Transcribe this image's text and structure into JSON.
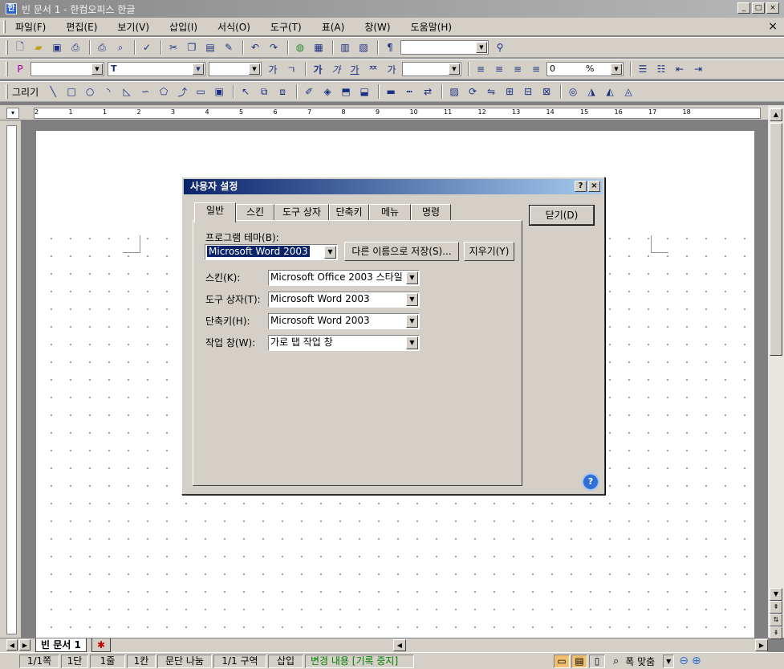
{
  "window": {
    "title": "빈 문서 1 - 한컴오피스 한글",
    "app_icon_glyph": "한"
  },
  "menu": {
    "items": [
      "파일(F)",
      "편집(E)",
      "보기(V)",
      "삽입(I)",
      "서식(O)",
      "도구(T)",
      "표(A)",
      "창(W)",
      "도움말(H)"
    ],
    "close_glyph": "×"
  },
  "toolbar_draw": {
    "label": "그리기"
  },
  "format_toolbar": {
    "font_value": "T",
    "size_value": "0",
    "percent": "%"
  },
  "colors": {
    "dialog_title_start": "#0a246a",
    "dialog_title_end": "#a6caf0",
    "selection": "#0a246a",
    "status_green": "#008000",
    "help_blue": "#2f6fd6"
  },
  "dialog": {
    "title": "사용자 설정",
    "tabs": [
      "일반",
      "스킨",
      "도구 상자",
      "단축키",
      "메뉴",
      "명령"
    ],
    "program_theme": {
      "label": "프로그램 테마(B):",
      "value": "Microsoft Word 2003"
    },
    "save_as_button": "다른 이름으로 저장(S)...",
    "delete_button": "지우기(Y)",
    "close_button": "닫기(D)",
    "fields": [
      {
        "label": "스킨(K):",
        "value": "Microsoft Office 2003 스타일"
      },
      {
        "label": "도구 상자(T):",
        "value": "Microsoft Word 2003"
      },
      {
        "label": "단축키(H):",
        "value": "Microsoft Word 2003"
      },
      {
        "label": "작업 창(W):",
        "value": "가로 탭 작업 창"
      }
    ],
    "help_glyph": "?"
  },
  "doc_tabs": {
    "active": "빈 문서 1"
  },
  "status": {
    "page": "1/1쪽",
    "column": "1단",
    "line": "1줄",
    "col": "1칸",
    "paragraph": "문단 나눔",
    "section": "1/1 구역",
    "insert": "삽입",
    "track": "변경 내용 [기록 중지]",
    "zoom": "폭 맞춤"
  },
  "ruler": {
    "ticks": [
      "2",
      "1",
      "1",
      "2",
      "3",
      "4",
      "5",
      "6",
      "7",
      "8",
      "9",
      "10",
      "11",
      "12",
      "13",
      "14",
      "15",
      "16",
      "17",
      "18"
    ]
  }
}
